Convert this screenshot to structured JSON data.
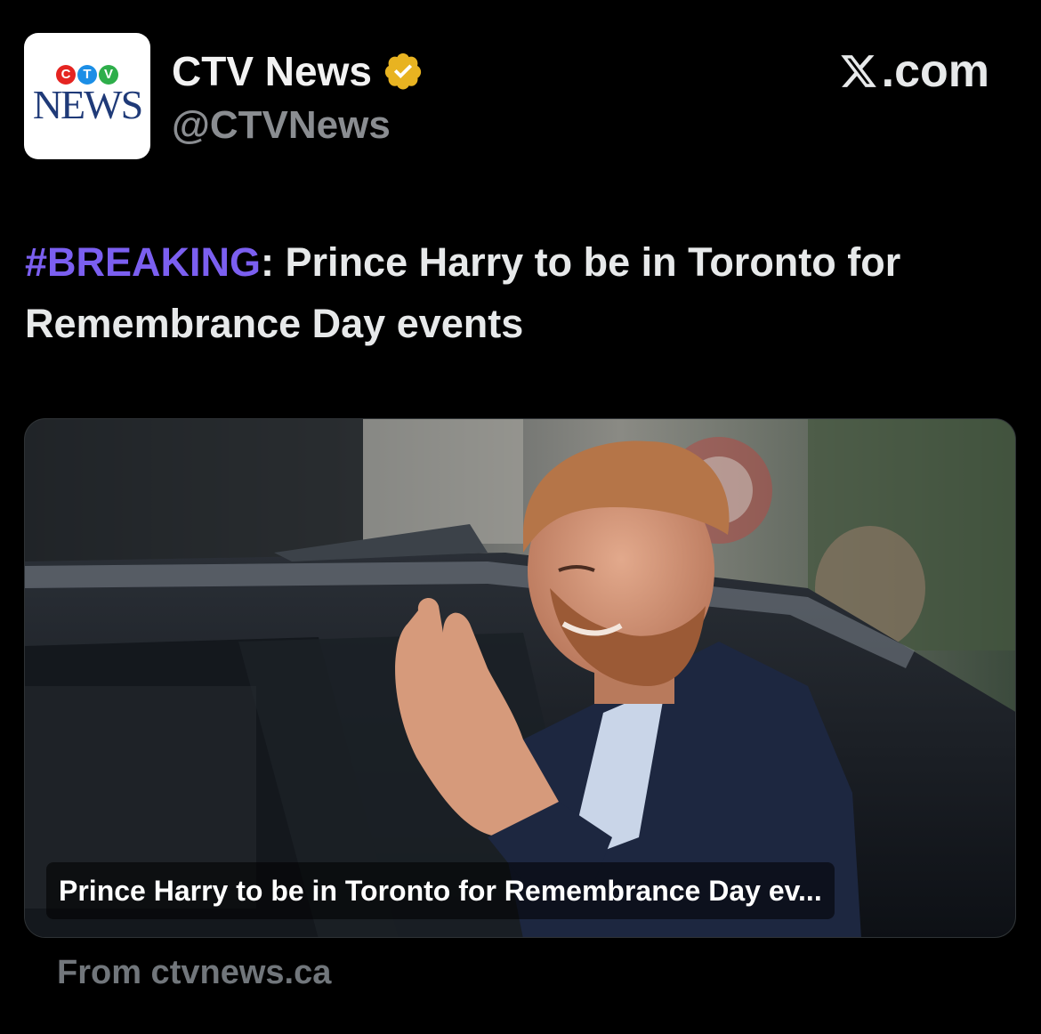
{
  "avatar": {
    "logo_letters": [
      "C",
      "T",
      "V"
    ],
    "logo_word": "NEWS",
    "letter_colors": [
      "#e52421",
      "#1b8ee6",
      "#2eae4a"
    ]
  },
  "account": {
    "name": "CTV News",
    "handle": "@CTVNews",
    "verified": true,
    "badge_color": "#e8b321"
  },
  "site": {
    "label": ".com",
    "icon": "x-logo-icon"
  },
  "tweet": {
    "hashtag": "#BREAKING",
    "text": ": Prince Harry to be in Toronto for Remembrance Day events",
    "hashtag_color": "#7b5ff0"
  },
  "link_card": {
    "image_description_icon": "photo",
    "caption": "Prince Harry to be in Toronto for Remembrance Day ev...",
    "source": "From ctvnews.ca"
  }
}
